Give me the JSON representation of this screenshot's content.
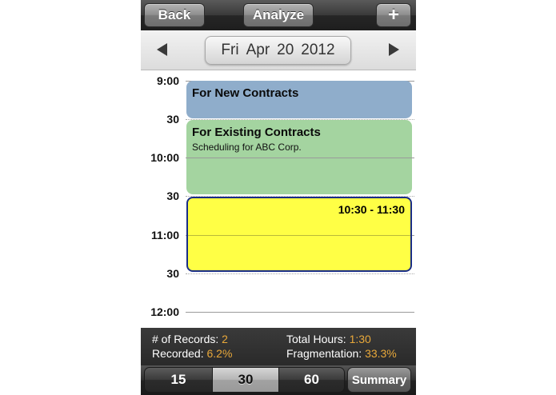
{
  "toolbar": {
    "back_label": "Back",
    "analyze_label": "Analyze",
    "add_label": "+"
  },
  "date_bar": {
    "weekday": "Fri",
    "month": "Apr",
    "day": "20",
    "year": "2012"
  },
  "time_labels": [
    "9:00",
    "30",
    "10:00",
    "30",
    "11:00",
    "30",
    "12:00"
  ],
  "events": [
    {
      "title": "For New Contracts",
      "subtitle": "",
      "color": "#8fadcb"
    },
    {
      "title": "For Existing Contracts",
      "subtitle": "Scheduling for ABC Corp.",
      "color": "#a4d4a0"
    },
    {
      "title": "",
      "time_range": "10:30 - 11:30",
      "color": "#ffff45",
      "selected": true
    }
  ],
  "summary": {
    "records_label": "# of Records:",
    "records_value": "2",
    "total_hours_label": "Total Hours:",
    "total_hours_value": "1:30",
    "recorded_label": "Recorded:",
    "recorded_value": "6.2%",
    "fragmentation_label": "Fragmentation:",
    "fragmentation_value": "33.3%",
    "value_color": "#e8a83a"
  },
  "interval_segments": {
    "options": [
      "15",
      "30",
      "60"
    ],
    "selected": "30"
  },
  "summary_button_label": "Summary"
}
